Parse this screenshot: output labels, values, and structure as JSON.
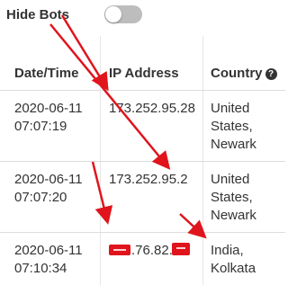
{
  "filter": {
    "hide_bots_label": "Hide Bots",
    "hide_bots_enabled": false
  },
  "table": {
    "headers": {
      "datetime": "Date/Time",
      "ip": "IP Address",
      "country": "Country"
    },
    "rows": [
      {
        "date": "2020-06-11",
        "time": "07:07:19",
        "ip": "173.252.95.28",
        "country_line1": "United",
        "country_line2": "States,",
        "city": "Newark"
      },
      {
        "date": "2020-06-11",
        "time": "07:07:20",
        "ip": "173.252.95.2",
        "country_line1": "United",
        "country_line2": "States,",
        "city": "Newark"
      },
      {
        "date": "2020-06-11",
        "time": "07:10:34",
        "ip": ".76.82.",
        "country_line1": "India,",
        "country_line2": "Kolkata",
        "city": ""
      }
    ]
  },
  "colors": {
    "annotation_red": "#e0141c",
    "toggle_off": "#bdbdbd"
  }
}
